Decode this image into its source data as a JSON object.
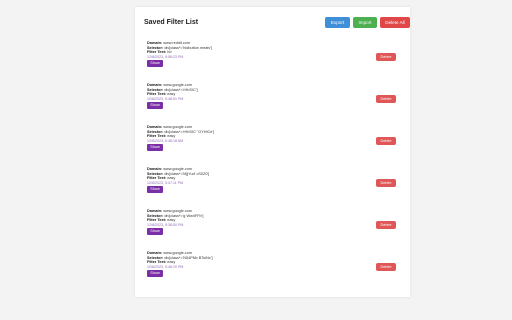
{
  "header": {
    "title": "Saved Filter List",
    "export_label": "Export",
    "import_label": "Import",
    "clear_all_label": "Delete All"
  },
  "labels": {
    "domain": "Domain:",
    "selector": "Selector:",
    "filter_text": "Filter Text:"
  },
  "entries": [
    {
      "domain": "www.reddit.com",
      "selector": "div[class*='hidbutton meatv']",
      "filter_text": "hd",
      "timestamp": "12/8/2023, 5:58:23 PM",
      "show_label": "Show",
      "delete_label": "Delete"
    },
    {
      "domain": "www.google.com",
      "selector": "div[class*='rHhSIC']",
      "filter_text": "easy",
      "timestamp": "12/8/2023, 5:48:51 PM",
      "show_label": "Show",
      "delete_label": "Delete"
    },
    {
      "domain": "www.google.com",
      "selector": "div[class*='rHhSIC' 'GYHICe']",
      "filter_text": "easy",
      "timestamp": "12/8/2023, 5:48:18 AM",
      "show_label": "Show",
      "delete_label": "Delete"
    },
    {
      "domain": "www.google.com",
      "selector": "div[class*='MjjYud' cS0Z0']",
      "filter_text": "easy",
      "timestamp": "12/8/2023, 5:47:11 PM",
      "show_label": "Show",
      "delete_label": "Delete"
    },
    {
      "domain": "www.google.com",
      "selector": "div[class*='g Ww4FFb']",
      "filter_text": "easy",
      "timestamp": "12/8/2023, 5:38:50 PM",
      "show_label": "Show",
      "delete_label": "Delete"
    },
    {
      "domain": "www.google.com",
      "selector": "div[class*='N54PNb BToiNc']",
      "filter_text": "easy",
      "timestamp": "12/8/2023, 5:46:20 PM",
      "show_label": "Show",
      "delete_label": "Delete"
    }
  ],
  "colors": {
    "export": "#3f8ed8",
    "import": "#4caf50",
    "delete_all": "#e04848",
    "delete": "#e05757",
    "show": "#7b2fa6",
    "timestamp": "#8e6bb5"
  }
}
